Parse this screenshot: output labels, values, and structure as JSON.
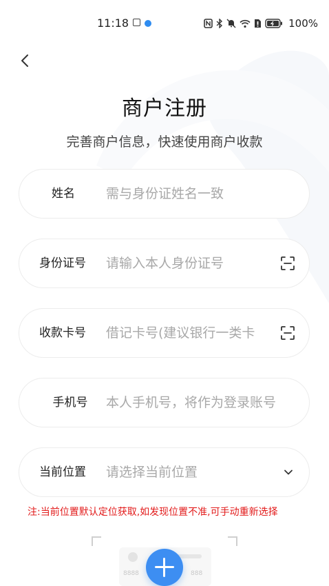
{
  "status_bar": {
    "time": "11:18",
    "battery_text": "100%",
    "icons": [
      "gallery-icon",
      "app-dot-icon",
      "nfc-icon",
      "bluetooth-icon",
      "mute-icon",
      "wifi-icon",
      "sim-icon",
      "battery-icon"
    ]
  },
  "header": {
    "title": "商户注册",
    "subtitle": "完善商户信息，快速使用商户收款"
  },
  "form": {
    "name": {
      "label": "姓名",
      "placeholder": "需与身份证姓名一致"
    },
    "id_card": {
      "label": "身份证号",
      "placeholder": "请输入本人身份证号"
    },
    "bank_card": {
      "label": "收款卡号",
      "placeholder": "借记卡号(建议银行一类卡"
    },
    "phone": {
      "label": "手机号",
      "placeholder": "本人手机号，将作为登录账号"
    },
    "location": {
      "label": "当前位置",
      "placeholder": "请选择当前位置"
    }
  },
  "notice": "注:当前位置默认定位获取,如发现位置不准,可手动重新选择",
  "card_preview": {
    "numbers": [
      "8888",
      "888"
    ]
  },
  "colors": {
    "accent": "#3d8ef2",
    "notice": "#e21b1b",
    "placeholder": "#a8a8a8"
  }
}
